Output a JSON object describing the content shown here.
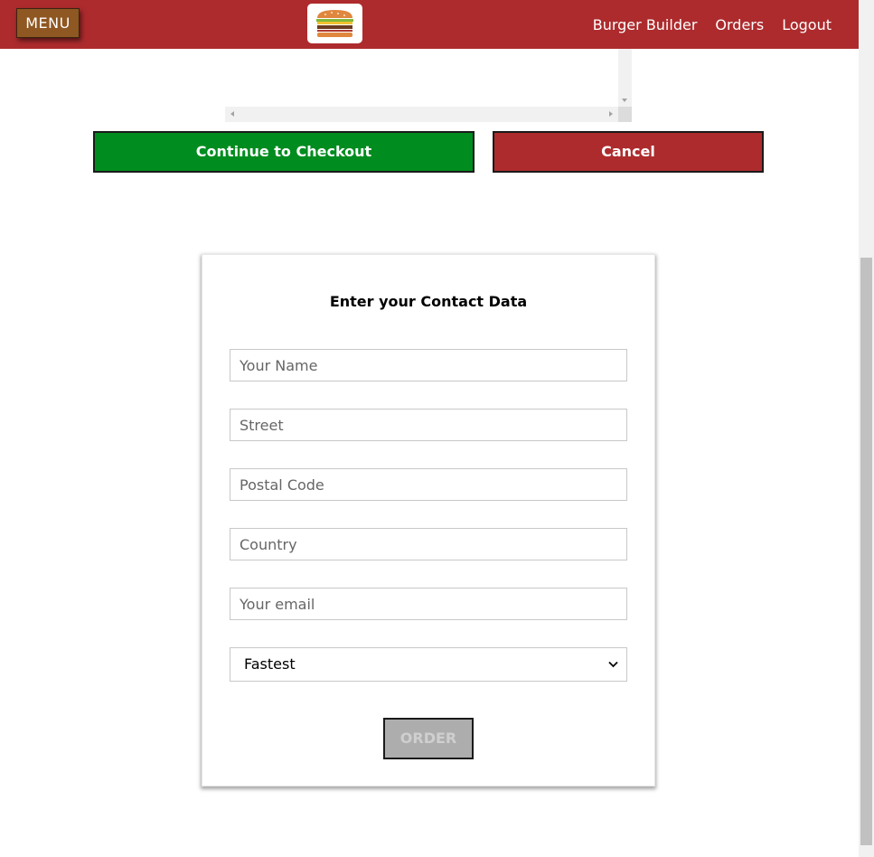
{
  "toolbar": {
    "menu_label": "MENU",
    "nav": [
      {
        "label": "Burger Builder"
      },
      {
        "label": "Orders"
      },
      {
        "label": "Logout"
      }
    ],
    "logo_icon": "burger-logo-icon",
    "brand_color": "#ad2b2d"
  },
  "checkout": {
    "continue_label": "Continue to Checkout",
    "cancel_label": "Cancel",
    "continue_color": "#008c1f",
    "cancel_color": "#ad2b2d"
  },
  "contact": {
    "title": "Enter your Contact Data",
    "fields": [
      {
        "placeholder": "Your Name",
        "value": ""
      },
      {
        "placeholder": "Street",
        "value": ""
      },
      {
        "placeholder": "Postal Code",
        "value": ""
      },
      {
        "placeholder": "Country",
        "value": ""
      },
      {
        "placeholder": "Your email",
        "value": ""
      }
    ],
    "delivery_method": {
      "selected": "Fastest"
    },
    "order_label": "ORDER",
    "order_disabled": true
  }
}
